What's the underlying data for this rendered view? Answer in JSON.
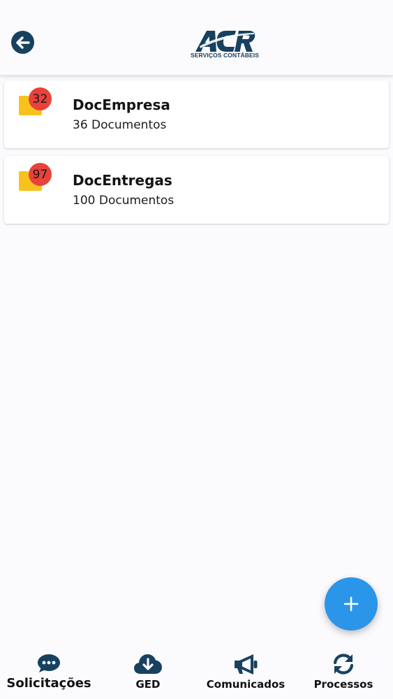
{
  "header": {
    "logo": {
      "word": "ACR",
      "subtitle": "SERVIÇOS CONTÁBEIS"
    },
    "back_icon": "arrow-left-circle-icon"
  },
  "folders": [
    {
      "name": "DocEmpresa",
      "count_label": "36 Documentos",
      "badge": "32"
    },
    {
      "name": "DocEntregas",
      "count_label": "100 Documentos",
      "badge": "97"
    }
  ],
  "fab": {
    "icon": "plus-icon"
  },
  "nav": [
    {
      "label": "Solicitações",
      "icon": "chat-bubble-icon"
    },
    {
      "label": "GED",
      "icon": "cloud-download-icon"
    },
    {
      "label": "Comunicados",
      "icon": "megaphone-icon"
    },
    {
      "label": "Processos",
      "icon": "sync-icon"
    }
  ],
  "colors": {
    "primary_navy": "#17415f",
    "folder_yellow": "#f7c21d",
    "badge_red": "#e8423a",
    "fab_blue": "#2b95ea",
    "background": "#fbfafd"
  }
}
